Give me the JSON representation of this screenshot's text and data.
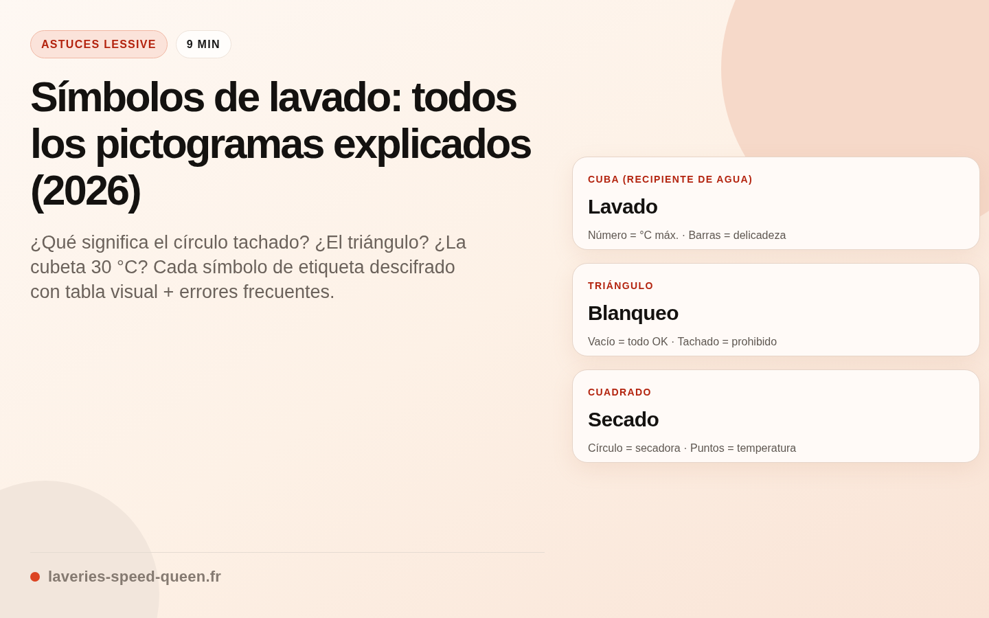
{
  "tags": [
    {
      "label": "ASTUCES LESSIVE",
      "kind": "category"
    },
    {
      "label": "9 MIN",
      "kind": "time"
    }
  ],
  "title": "Símbolos de lavado: todos los pictogramas explicados (2026)",
  "subtitle": "¿Qué significa el círculo tachado? ¿El triángulo? ¿La cubeta 30 °C? Cada símbolo de etiqueta descifrado con tabla visual + errores frecuentes.",
  "cards": [
    {
      "eyebrow": "CUBA (RECIPIENTE DE AGUA)",
      "heading": "Lavado",
      "note": "Número = °C máx. · Barras = delicadeza"
    },
    {
      "eyebrow": "TRIÁNGULO",
      "heading": "Blanqueo",
      "note": "Vacío = todo OK · Tachado = prohibido"
    },
    {
      "eyebrow": "CUADRADO",
      "heading": "Secado",
      "note": "Círculo = secadora · Puntos = temperatura"
    }
  ],
  "footer": {
    "site": "laveries-speed-queen.fr"
  }
}
